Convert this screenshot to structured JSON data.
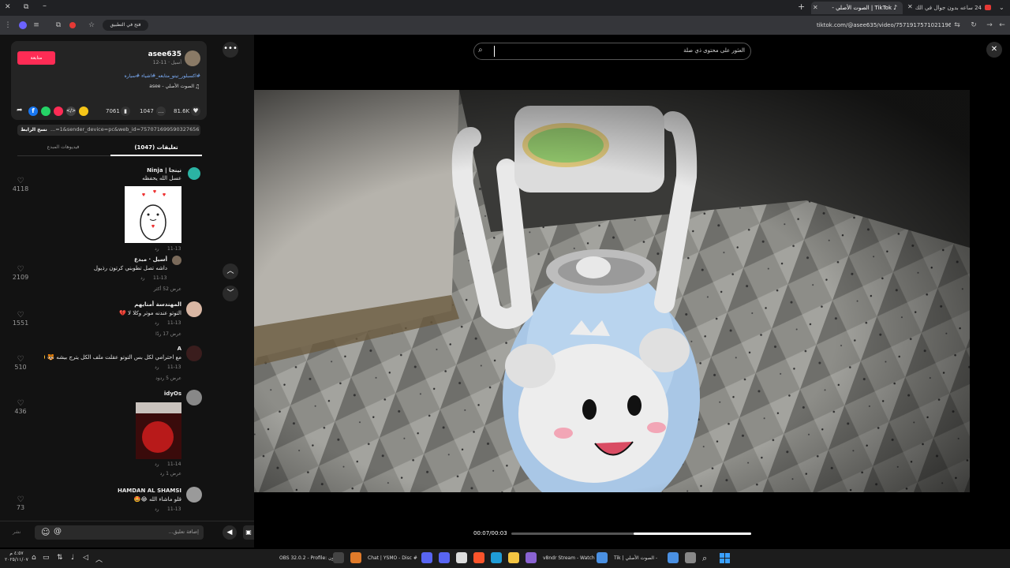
{
  "browser": {
    "tabs": [
      {
        "label": "24 ساعه بدون جوال في الك..."
      },
      {
        "label": "TikTok | الصوت الأصلي -"
      },
      {
        "label": "+"
      }
    ],
    "open_in_app_label": "فتح في التطبيق",
    "url": "tiktok.com/@asee635/video/7571917571021196552"
  },
  "post": {
    "username": "asee635",
    "display_meta": "أسيل · 11-12",
    "follow_label": "متابعة",
    "hashtags": "#اكسبلور_تيتو_متابعه_#اشياء #سياره",
    "sound": "الصوت الأصلي - asee",
    "likes": "81.6K",
    "comments": "1047",
    "saves": "7061",
    "link_text": "...=1&sender_device=pc&web_id=7570716995903276562",
    "copy_link_label": "نسخ الرابط",
    "tab_comments": "تعليقات (1047)",
    "tab_creator_videos": "فيديوهات المبدع"
  },
  "comments": [
    {
      "name": "نينجا | Ninja",
      "text": "عسل الله يحفظه",
      "date": "11-13",
      "reply": "رد",
      "likes": "4118"
    },
    {
      "name": "أسيل · مبدع",
      "text": "داشه تصل تطوبني كرتون رذيول",
      "date": "11-13",
      "reply": "رد",
      "view_replies": "عرض 52 أكثر",
      "likes": "2109"
    },
    {
      "name": "المهندسة أمنايهم",
      "text": "التوتو عندنه موتر وكلا لا 💔",
      "date": "11-13",
      "reply": "رد",
      "view_replies": "عرض 17 ردًا",
      "likes": "1551"
    },
    {
      "name": "A",
      "text": "مع احترامي لكل بس التوتو عقلت ملف الكل يترج بيشه 🐯 🤭😂",
      "date": "11-13",
      "reply": "رد",
      "view_replies": "عرض 5 ردود",
      "likes": "510"
    },
    {
      "name": "idyOs",
      "text": "",
      "date": "11-14",
      "reply": "رد",
      "view_replies": "عرض 1 رد",
      "likes": "436"
    },
    {
      "name": "HAMDAN AL SHAMSI",
      "text": "قلو ماشاء الله 😂🤩",
      "date": "11-13",
      "reply": "رد",
      "likes": "73"
    }
  ],
  "composer": {
    "placeholder": "إضافة تعليق...",
    "send_label": "نشر"
  },
  "video": {
    "search_placeholder": "العثور على محتوى ذي صلة",
    "time": "00:07/00:03",
    "progress": 0.49
  },
  "taskbar": {
    "items": [
      {
        "label": "OBS 32.0.2 - Profile: بدون"
      },
      {
        "label": "Chat | YSMO - Disc #"
      },
      {
        "label": "v8ndr Stream - Watch L"
      },
      {
        "label": "Tik | الصوت الأصلي -"
      }
    ],
    "time": "٤:٥٧ م",
    "date": "٢٠٢٥/١١/٠٧"
  }
}
